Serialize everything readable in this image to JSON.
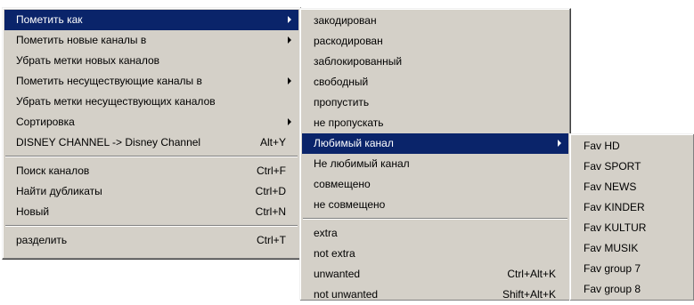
{
  "menu1": {
    "mark_as": "Пометить как",
    "mark_new_channels_in": "Пометить новые каналы в",
    "remove_new_channel_marks": "Убрать метки новых каналов",
    "mark_nonexistent_channels_in": "Пометить несуществующие каналы в",
    "remove_nonexistent_channel_marks": "Убрать метки несуществующих каналов",
    "sort": "Сортировка",
    "rename_disney": "DISNEY CHANNEL -> Disney Channel",
    "rename_disney_shortcut": "Alt+Y",
    "channel_search": "Поиск каналов",
    "channel_search_shortcut": "Ctrl+F",
    "find_duplicates": "Найти дубликаты",
    "find_duplicates_shortcut": "Ctrl+D",
    "new": "Новый",
    "new_shortcut": "Ctrl+N",
    "split": "разделить",
    "split_shortcut": "Ctrl+T"
  },
  "menu2": {
    "encoded": "закодирован",
    "decoded": "раскодирован",
    "blocked": "заблокированный",
    "free": "свободный",
    "skip": "пропустить",
    "dont_skip": "не пропускать",
    "favorite_channel": "Любимый канал",
    "not_favorite_channel": "Не любимый канал",
    "combined": "совмещено",
    "not_combined": "не совмещено",
    "extra": "extra",
    "not_extra": "not extra",
    "unwanted": "unwanted",
    "unwanted_shortcut": "Ctrl+Alt+K",
    "not_unwanted": "not unwanted",
    "not_unwanted_shortcut": "Shift+Alt+K"
  },
  "menu3": {
    "items": [
      "Fav HD",
      "Fav SPORT",
      "Fav NEWS",
      "Fav KINDER",
      "Fav KULTUR",
      "Fav MUSIK",
      "Fav group 7",
      "Fav group 8"
    ]
  },
  "colors": {
    "menu_bg": "#d4d0c8",
    "highlight": "#0a246a",
    "highlight_text": "#ffffff"
  }
}
